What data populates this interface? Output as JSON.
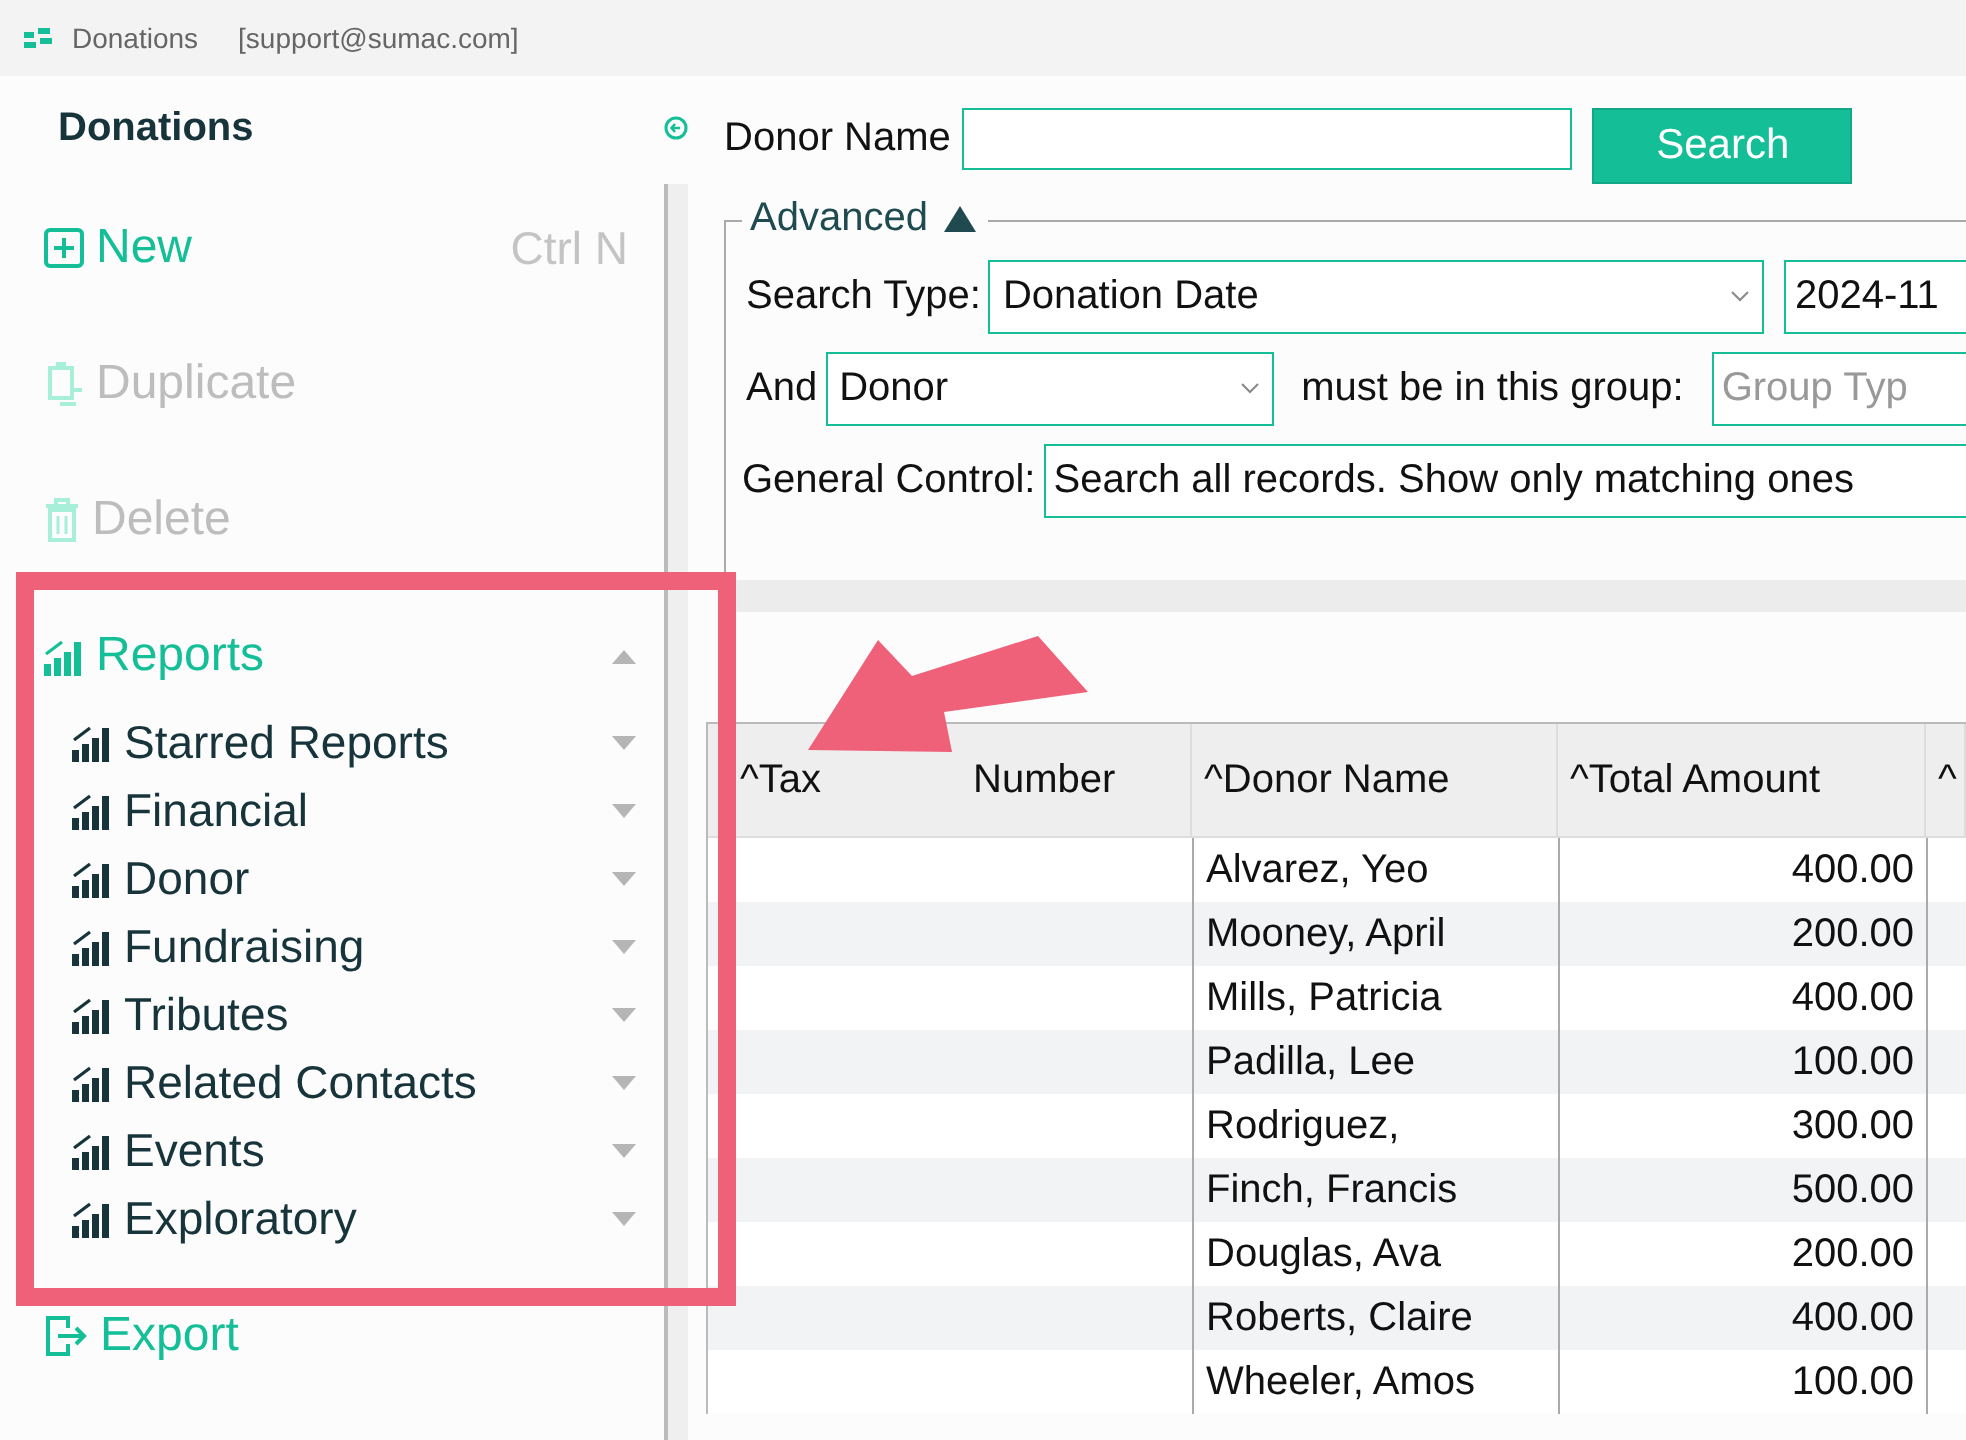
{
  "window": {
    "app_title": "Donations",
    "account": "[support@sumac.com]"
  },
  "sidebar": {
    "title": "Donations",
    "actions": [
      {
        "kind": "new",
        "label": "New",
        "shortcut": "Ctrl N",
        "disabled": false
      },
      {
        "kind": "duplicate",
        "label": "Duplicate",
        "disabled": true
      },
      {
        "kind": "delete",
        "label": "Delete",
        "disabled": true
      }
    ],
    "reports": {
      "label": "Reports",
      "expanded": true,
      "children": [
        {
          "label": "Starred Reports",
          "expanded": false
        },
        {
          "label": "Financial",
          "expanded": false
        },
        {
          "label": "Donor",
          "expanded": false
        },
        {
          "label": "Fundraising",
          "expanded": false
        },
        {
          "label": "Tributes",
          "expanded": false
        },
        {
          "label": "Related Contacts",
          "expanded": false
        },
        {
          "label": "Events",
          "expanded": false
        },
        {
          "label": "Exploratory",
          "expanded": false
        }
      ]
    },
    "export": {
      "kind": "export",
      "label": "Export",
      "disabled": false
    }
  },
  "search": {
    "label": "Donor Name",
    "button": "Search"
  },
  "advanced": {
    "label": "Advanced",
    "expanded": true,
    "search_type_label": "Search Type:",
    "search_type": "Donation Date",
    "date": "2024-11",
    "and_label": "And",
    "group_kind": "Donor",
    "group_label": "must be in this group:",
    "group_placeholder": "Group Typ",
    "general_label": "General Control:",
    "general": "Search all records. Show only matching ones"
  },
  "table": {
    "columns": [
      {
        "before": "^Tax",
        "after": "Number"
      },
      {
        "label": "^Donor Name"
      },
      {
        "label": "^Total Amount"
      },
      {
        "label": "^"
      }
    ],
    "rows": [
      {
        "donor": "Alvarez, Yeo",
        "amount": "400.00"
      },
      {
        "donor": "Mooney, April",
        "amount": "200.00"
      },
      {
        "donor": "Mills, Patricia",
        "amount": "400.00"
      },
      {
        "donor": "Padilla, Lee",
        "amount": "100.00"
      },
      {
        "donor": "Rodriguez,",
        "amount": "300.00"
      },
      {
        "donor": "Finch, Francis",
        "amount": "500.00"
      },
      {
        "donor": "Douglas, Ava",
        "amount": "200.00"
      },
      {
        "donor": "Roberts, Claire",
        "amount": "400.00"
      },
      {
        "donor": "Wheeler, Amos",
        "amount": "100.00"
      }
    ]
  }
}
